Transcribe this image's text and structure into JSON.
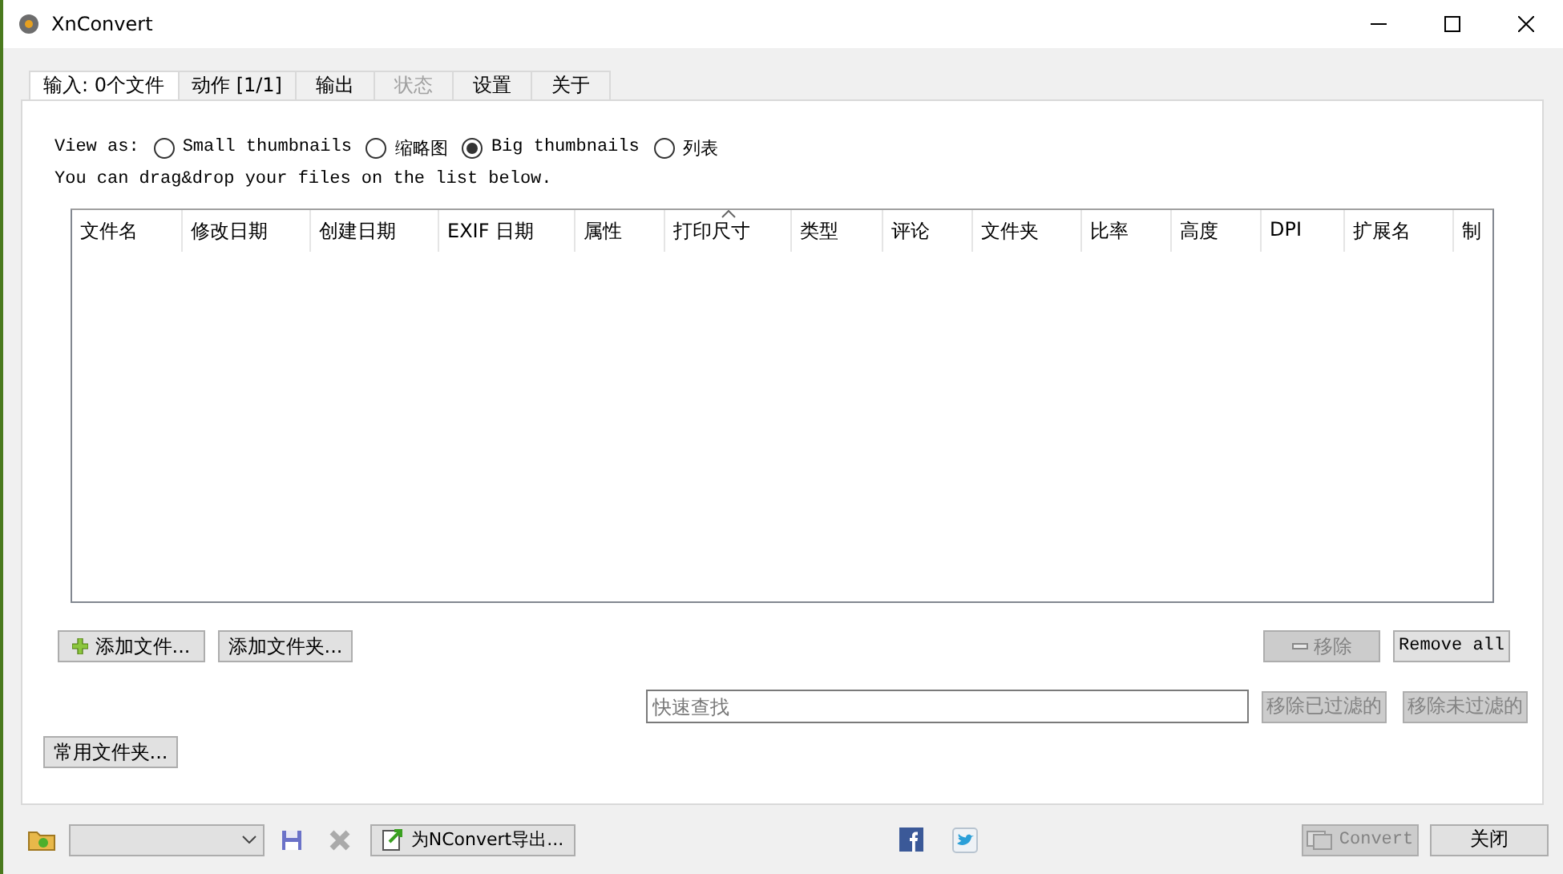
{
  "window": {
    "title": "XnConvert"
  },
  "tabs": [
    {
      "label": "输入: 0个文件",
      "selected": true,
      "disabled": false
    },
    {
      "label": "动作 [1/1]",
      "selected": false,
      "disabled": false
    },
    {
      "label": "输出",
      "selected": false,
      "disabled": false
    },
    {
      "label": "状态",
      "selected": false,
      "disabled": true
    },
    {
      "label": "设置",
      "selected": false,
      "disabled": false
    },
    {
      "label": "关于",
      "selected": false,
      "disabled": false
    }
  ],
  "view_as": {
    "label": "View as:",
    "options": [
      {
        "label": "Small thumbnails",
        "selected": false
      },
      {
        "label": "缩略图",
        "selected": false
      },
      {
        "label": "Big thumbnails",
        "selected": true
      },
      {
        "label": "列表",
        "selected": false
      }
    ]
  },
  "hint": "You can drag&drop your files on the list below.",
  "table": {
    "columns": [
      {
        "label": "文件名",
        "sorted": false
      },
      {
        "label": "修改日期",
        "sorted": false
      },
      {
        "label": "创建日期",
        "sorted": false
      },
      {
        "label": "EXIF 日期",
        "sorted": false
      },
      {
        "label": "属性",
        "sorted": false
      },
      {
        "label": "打印尺寸",
        "sorted": true
      },
      {
        "label": "类型",
        "sorted": false
      },
      {
        "label": "评论",
        "sorted": false
      },
      {
        "label": "文件夹",
        "sorted": false
      },
      {
        "label": "比率",
        "sorted": false
      },
      {
        "label": "高度",
        "sorted": false
      },
      {
        "label": "DPI",
        "sorted": false
      },
      {
        "label": "扩展名",
        "sorted": false
      },
      {
        "label": "制",
        "sorted": false
      }
    ]
  },
  "add_buttons": [
    {
      "label": "添加文件...",
      "kind": "file"
    },
    {
      "label": "添加文件夹...",
      "kind": "folder"
    }
  ],
  "remove_buttons": [
    {
      "label": "移除",
      "kind": "remove",
      "disabled": true
    },
    {
      "label": "Remove all",
      "kind": "remove_all",
      "disabled": false
    }
  ],
  "search": {
    "placeholder": "快速查找"
  },
  "filter_buttons": [
    {
      "label": "移除已过滤的",
      "disabled": true
    },
    {
      "label": "移除未过滤的",
      "disabled": true
    }
  ],
  "favorites_button": {
    "label": "常用文件夹..."
  },
  "bottom_bar": {
    "export_button": {
      "label": "为NConvert导出..."
    },
    "convert_button": {
      "label": "Convert",
      "disabled": true
    },
    "close_button": {
      "label": "关闭"
    }
  }
}
